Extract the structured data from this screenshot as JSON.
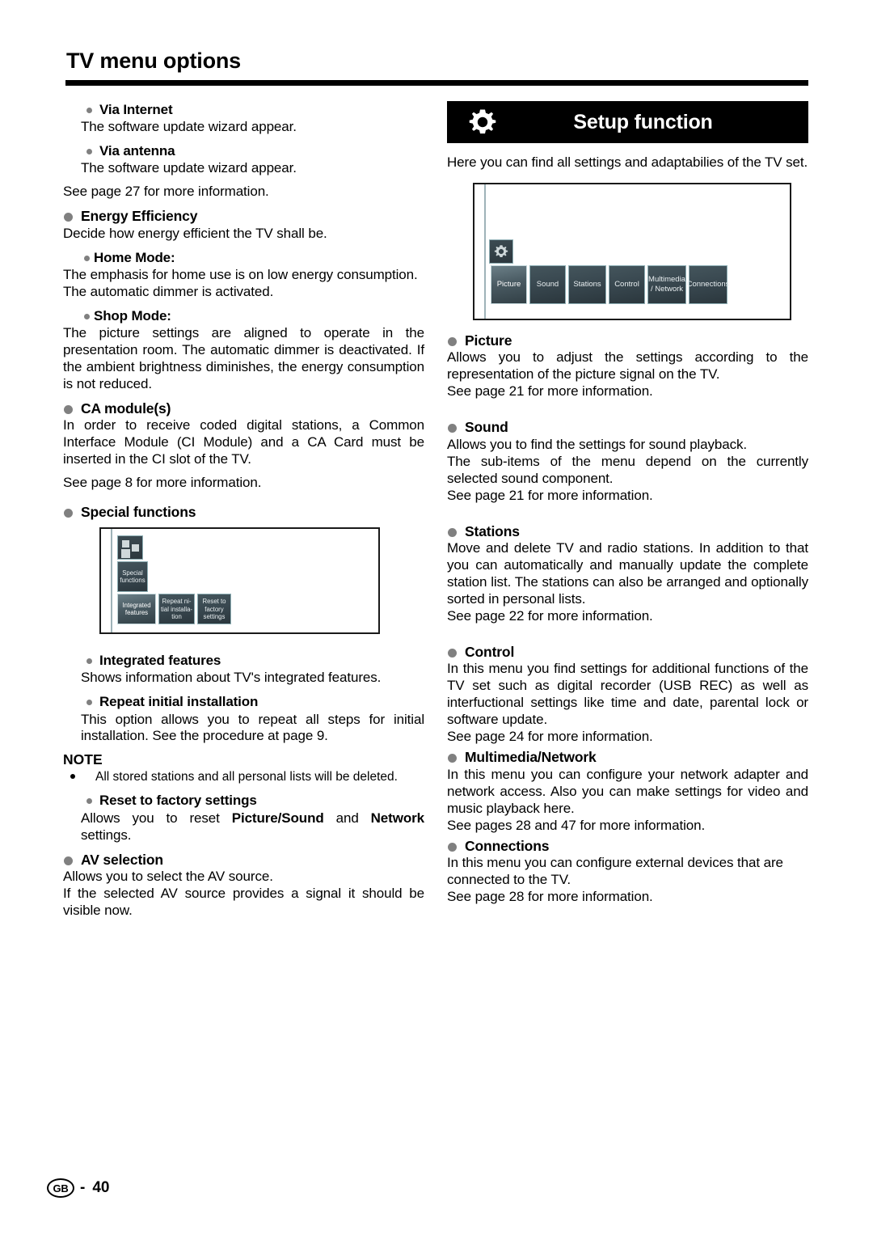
{
  "header": {
    "title": "TV menu options"
  },
  "left_column": {
    "via_internet": {
      "heading": "Via Internet",
      "body": "The software update wizard appear."
    },
    "via_antenna": {
      "heading": "Via antenna",
      "body": "The software update wizard appear."
    },
    "see_page_27": "See page 27 for more information.",
    "energy_efficiency": {
      "heading": "Energy Efficiency",
      "body": "Decide how energy efficient the TV shall be."
    },
    "home_mode": {
      "heading": "Home Mode:",
      "body": "The emphasis for home use is on low energy consumption.",
      "body2": "The automatic dimmer is activated."
    },
    "shop_mode": {
      "heading": "Shop Mode:",
      "body": "The picture settings are aligned to operate in the presentation room. The automatic dimmer is deactivated. If the ambient brightness diminishes, the energy consumption is not reduced."
    },
    "ca_modules": {
      "heading": "CA module(s)",
      "body": "In order to receive coded digital stations, a Common Interface Module (CI Module) and a CA Card must be inserted in the CI slot of the TV.",
      "see_page": "See page 8 for more information."
    },
    "special_functions": {
      "heading": "Special functions"
    },
    "integrated_features": {
      "heading": "Integrated features",
      "body": "Shows information about TV's integrated features."
    },
    "repeat_initial_installation": {
      "heading": "Repeat initial installation",
      "body": "This option allows you to repeat all steps for initial installation. See the procedure at page 9."
    },
    "note": {
      "heading": "NOTE",
      "item": "All stored stations and all personal lists will be deleted."
    },
    "reset_factory": {
      "heading": "Reset to factory settings",
      "body_part1": "Allows you to reset ",
      "body_bold1": "Picture/Sound",
      "body_part2": " and ",
      "body_bold2": "Network",
      "body_part3": " settings."
    },
    "av_selection": {
      "heading": "AV selection",
      "body": "Allows you to select the AV source.",
      "body2": "If the selected AV source provides a signal it should be visible now."
    }
  },
  "right_column": {
    "banner": {
      "title": "Setup function",
      "icon": "gear-icon"
    },
    "intro": "Here you can find all settings and adaptabilies of the TV set.",
    "picture": {
      "heading": "Picture",
      "body": "Allows you to adjust the settings according to the representation of the picture signal on the TV.",
      "see_page": "See page 21 for more information."
    },
    "sound": {
      "heading": "Sound",
      "body": "Allows you to find the settings for sound playback.",
      "body2": "The sub-items of the menu depend on the currently selected sound component.",
      "see_page": "See page 21 for more information."
    },
    "stations": {
      "heading": "Stations",
      "body": "Move and delete TV and radio stations. In addition to that you can automatically and manually update the complete station list. The stations can also be arranged and optionally sorted in personal lists.",
      "see_page": "See page 22 for more information."
    },
    "control": {
      "heading": "Control",
      "body": "In this menu you find settings for additional functions of the TV set such as digital recorder (USB REC) as well as interfuctional settings like time and date, parental lock or software update.",
      "see_page": "See page 24 for more information."
    },
    "multimedia_network": {
      "heading": "Multimedia/Network",
      "body": "In this menu you can configure your network adapter and network access. Also you can make settings for video and music playback here.",
      "see_page": "See pages 28 and 47 for more information."
    },
    "connections": {
      "heading": "Connections",
      "body": "In this menu you can configure external devices that are connected to the TV.",
      "see_page": "See page 28 for more information."
    }
  },
  "setup_menu_screenshot": {
    "icon": "gear-icon",
    "tiles": [
      {
        "label": "Picture",
        "selected": true
      },
      {
        "label": "Sound",
        "selected": false
      },
      {
        "label": "Stations",
        "selected": false
      },
      {
        "label": "Control",
        "selected": false
      },
      {
        "label": "Multimedia\n/ Network",
        "selected": false
      },
      {
        "label": "Connections",
        "selected": false
      }
    ]
  },
  "special_functions_screenshot": {
    "icon": "four-squares-icon",
    "category_tile": "Special\nfunctions",
    "tiles": [
      {
        "label": "Integrated\nfeatures",
        "selected": true
      },
      {
        "label": "Repeat ni-\ntial installa-\ntion",
        "selected": false
      },
      {
        "label": "Reset to\nfactory\nsettings",
        "selected": false
      }
    ]
  },
  "footer": {
    "region": "GB",
    "separator": "-",
    "page_number": "40"
  }
}
